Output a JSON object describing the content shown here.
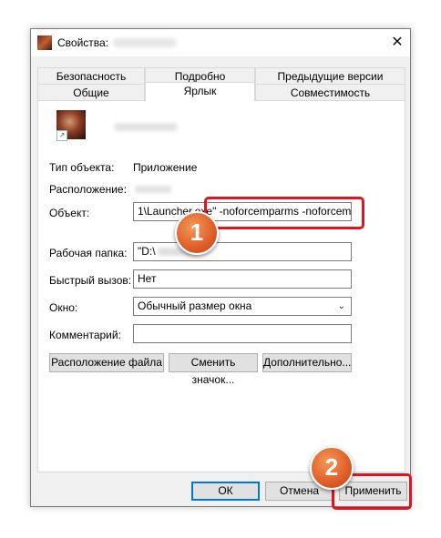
{
  "window": {
    "title": "Свойства:",
    "close_glyph": "✕",
    "icon": "app-icon"
  },
  "tabs": {
    "row1": [
      "Безопасность",
      "Подробно",
      "Предыдущие версии"
    ],
    "row2": [
      "Общие",
      "Ярлык",
      "Совместимость"
    ],
    "active": "Ярлык"
  },
  "fields": {
    "type_label": "Тип объекта:",
    "type_value": "Приложение",
    "location_label": "Расположение:",
    "target_label": "Объект:",
    "target_value_left": "1\\Launcher.exe\"",
    "target_value_right": "-noforcemparms -noforcemaccel",
    "workdir_label": "Рабочая папка:",
    "workdir_value": "\"D:\\",
    "hotkey_label": "Быстрый вызов:",
    "hotkey_value": "Нет",
    "window_label": "Окно:",
    "window_value": "Обычный размер окна",
    "comment_label": "Комментарий:",
    "comment_value": ""
  },
  "buttons": {
    "open_location": "Расположение файла",
    "change_icon": "Сменить значок...",
    "advanced": "Дополнительно...",
    "ok": "ОК",
    "cancel": "Отмена",
    "apply": "Применить"
  },
  "markers": {
    "one": "1",
    "two": "2"
  },
  "colors": {
    "highlight": "#e0141e",
    "marker": "#e2622a",
    "default_button": "#0078d7"
  }
}
